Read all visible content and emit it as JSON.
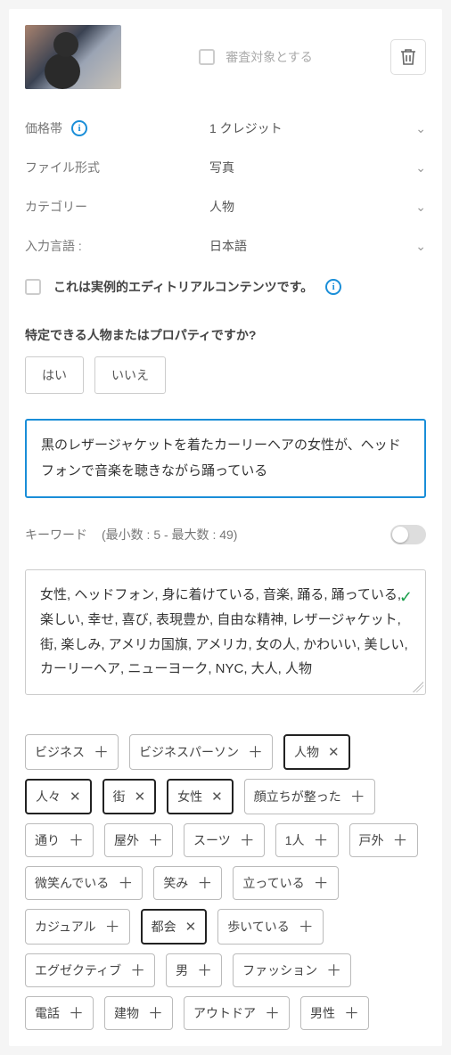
{
  "header": {
    "review_label": "審査対象とする"
  },
  "fields": {
    "price_label": "価格帯",
    "price_value": "1 クレジット",
    "filetype_label": "ファイル形式",
    "filetype_value": "写真",
    "category_label": "カテゴリー",
    "category_value": "人物",
    "language_label": "入力言語 :",
    "language_value": "日本語"
  },
  "editorial": {
    "label": "これは実例的エディトリアルコンテンツです。"
  },
  "identify": {
    "question": "特定できる人物またはプロパティですか?",
    "yes": "はい",
    "no": "いいえ"
  },
  "description": "黒のレザージャケットを着たカーリーヘアの女性が、ヘッドフォンで音楽を聴きながら踊っている",
  "keywords": {
    "label": "キーワード",
    "count_hint": "(最小数 : 5 - 最大数 : 49)",
    "text": "女性, ヘッドフォン, 身に着けている, 音楽, 踊る, 踊っている, 楽しい, 幸せ, 喜び, 表現豊か, 自由な精神, レザージャケット, 街, 楽しみ, アメリカ国旗, アメリカ, 女の人, かわいい, 美しい, カーリーヘア, ニューヨーク, NYC, 大人, 人物"
  },
  "tags": [
    {
      "label": "ビジネス",
      "selected": false
    },
    {
      "label": "ビジネスパーソン",
      "selected": false
    },
    {
      "label": "人物",
      "selected": true
    },
    {
      "label": "人々",
      "selected": true
    },
    {
      "label": "街",
      "selected": true
    },
    {
      "label": "女性",
      "selected": true
    },
    {
      "label": "顔立ちが整った",
      "selected": false
    },
    {
      "label": "通り",
      "selected": false
    },
    {
      "label": "屋外",
      "selected": false
    },
    {
      "label": "スーツ",
      "selected": false
    },
    {
      "label": "1人",
      "selected": false
    },
    {
      "label": "戸外",
      "selected": false
    },
    {
      "label": "微笑んでいる",
      "selected": false
    },
    {
      "label": "笑み",
      "selected": false
    },
    {
      "label": "立っている",
      "selected": false
    },
    {
      "label": "カジュアル",
      "selected": false
    },
    {
      "label": "都会",
      "selected": true
    },
    {
      "label": "歩いている",
      "selected": false
    },
    {
      "label": "エグゼクティブ",
      "selected": false
    },
    {
      "label": "男",
      "selected": false
    },
    {
      "label": "ファッション",
      "selected": false
    },
    {
      "label": "電話",
      "selected": false
    },
    {
      "label": "建物",
      "selected": false
    },
    {
      "label": "アウトドア",
      "selected": false
    },
    {
      "label": "男性",
      "selected": false
    }
  ]
}
